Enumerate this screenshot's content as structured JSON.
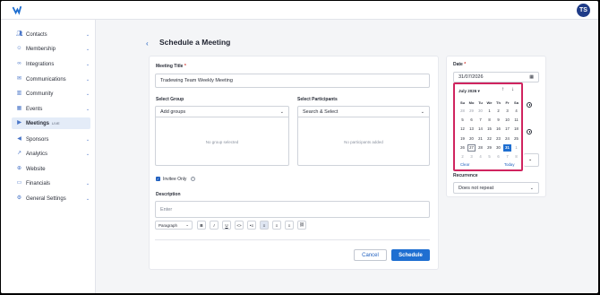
{
  "header": {
    "avatar_initials": "TS"
  },
  "sidebar": {
    "items": [
      {
        "label": "Contacts",
        "icon": "users-icon",
        "chevron": true
      },
      {
        "label": "Membership",
        "icon": "user-icon",
        "chevron": true
      },
      {
        "label": "Integrations",
        "icon": "link-icon",
        "chevron": true
      },
      {
        "label": "Communications",
        "icon": "mail-icon",
        "chevron": true
      },
      {
        "label": "Community",
        "icon": "book-icon",
        "chevron": true
      },
      {
        "label": "Events",
        "icon": "calendar-icon",
        "chevron": true
      },
      {
        "label": "Meetings",
        "icon": "video-icon",
        "chevron": false,
        "badge": "LIVE",
        "active": true
      },
      {
        "label": "Sponsors",
        "icon": "megaphone-icon",
        "chevron": true
      },
      {
        "label": "Analytics",
        "icon": "chart-icon",
        "chevron": true
      },
      {
        "label": "Website",
        "icon": "globe-icon",
        "chevron": false
      },
      {
        "label": "Financials",
        "icon": "wallet-icon",
        "chevron": true
      },
      {
        "label": "General Settings",
        "icon": "gear-icon",
        "chevron": true
      }
    ]
  },
  "page": {
    "back_icon": "chevron-left-icon",
    "title": "Schedule a Meeting"
  },
  "form": {
    "meeting_title_label": "Meeting Title",
    "required_mark": "*",
    "meeting_title_value": "Tradewing Team Weekly Meeting",
    "select_group_label": "Select Group",
    "select_group_placeholder": "Add groups",
    "no_group_text": "No group selected",
    "select_participants_label": "Select Participants",
    "select_participants_placeholder": "Search & Select",
    "no_participants_text": "No participants added",
    "invitee_only_label": "Invitee Only",
    "invitee_only_checked": true,
    "description_label": "Description",
    "description_placeholder": "Enter",
    "toolbar": {
      "paragraph_label": "Paragraph",
      "buttons": [
        {
          "name": "bold-button",
          "glyph": "B"
        },
        {
          "name": "italic-button",
          "glyph": "I"
        },
        {
          "name": "underline-button",
          "glyph": "U"
        },
        {
          "name": "code-button",
          "glyph": "<>"
        },
        {
          "name": "bullet-list-button",
          "glyph": "•≡"
        },
        {
          "name": "align-left-button",
          "glyph": "≡",
          "selected": true
        },
        {
          "name": "align-center-button",
          "glyph": "≡"
        },
        {
          "name": "align-right-button",
          "glyph": "≡"
        },
        {
          "name": "link-button",
          "glyph": "⛓"
        }
      ]
    },
    "cancel_label": "Cancel",
    "schedule_label": "Schedule"
  },
  "side": {
    "date_label": "Date",
    "date_value": "31/07/2026",
    "recurrence_label": "Recurrence",
    "recurrence_value": "Does not repeat"
  },
  "calendar": {
    "month_label": "July 2026",
    "weekdays": [
      "Su",
      "Mo",
      "Tu",
      "We",
      "Th",
      "Fr",
      "Sa"
    ],
    "weeks": [
      [
        "28",
        "29",
        "30",
        "1",
        "2",
        "3",
        "4"
      ],
      [
        "5",
        "6",
        "7",
        "8",
        "9",
        "10",
        "11"
      ],
      [
        "12",
        "13",
        "14",
        "15",
        "16",
        "17",
        "18"
      ],
      [
        "19",
        "20",
        "21",
        "22",
        "23",
        "24",
        "25"
      ],
      [
        "26",
        "27",
        "28",
        "29",
        "30",
        "31",
        "1"
      ],
      [
        "2",
        "3",
        "4",
        "5",
        "6",
        "7",
        "8"
      ]
    ],
    "selected_day": "31",
    "today_day": "27",
    "clear_label": "Clear",
    "today_label": "Today"
  },
  "colors": {
    "accent": "#1f6fd1",
    "highlight_border": "#d0245f",
    "avatar_bg": "#1f3c88"
  }
}
